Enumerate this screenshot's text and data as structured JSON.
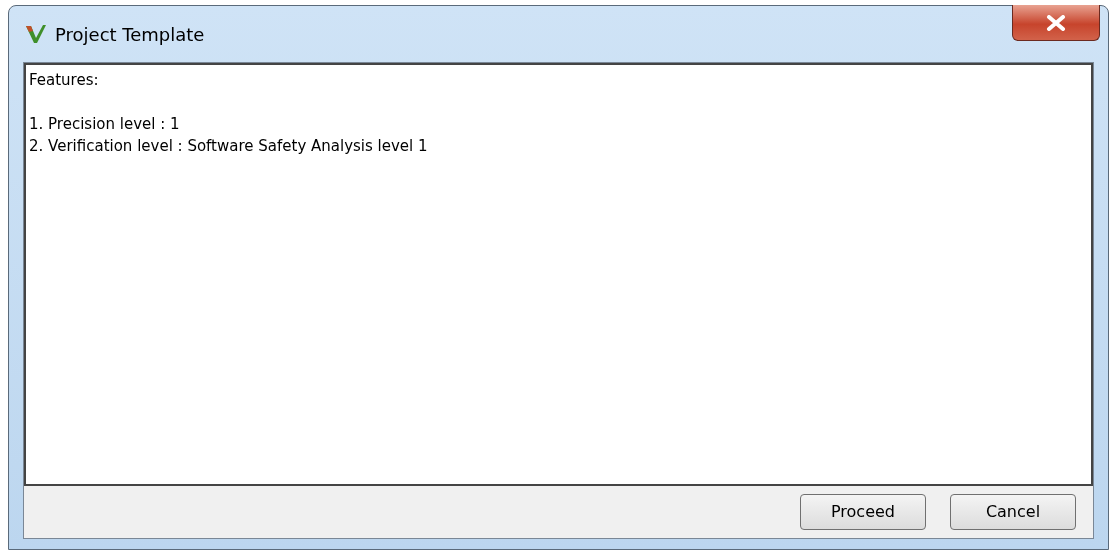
{
  "window": {
    "title": "Project Template"
  },
  "content": {
    "heading": "Features:",
    "items": [
      "1. Precision level : 1",
      "2. Verification level : Software Safety Analysis level 1"
    ]
  },
  "buttons": [
    "Proceed",
    "Cancel"
  ]
}
